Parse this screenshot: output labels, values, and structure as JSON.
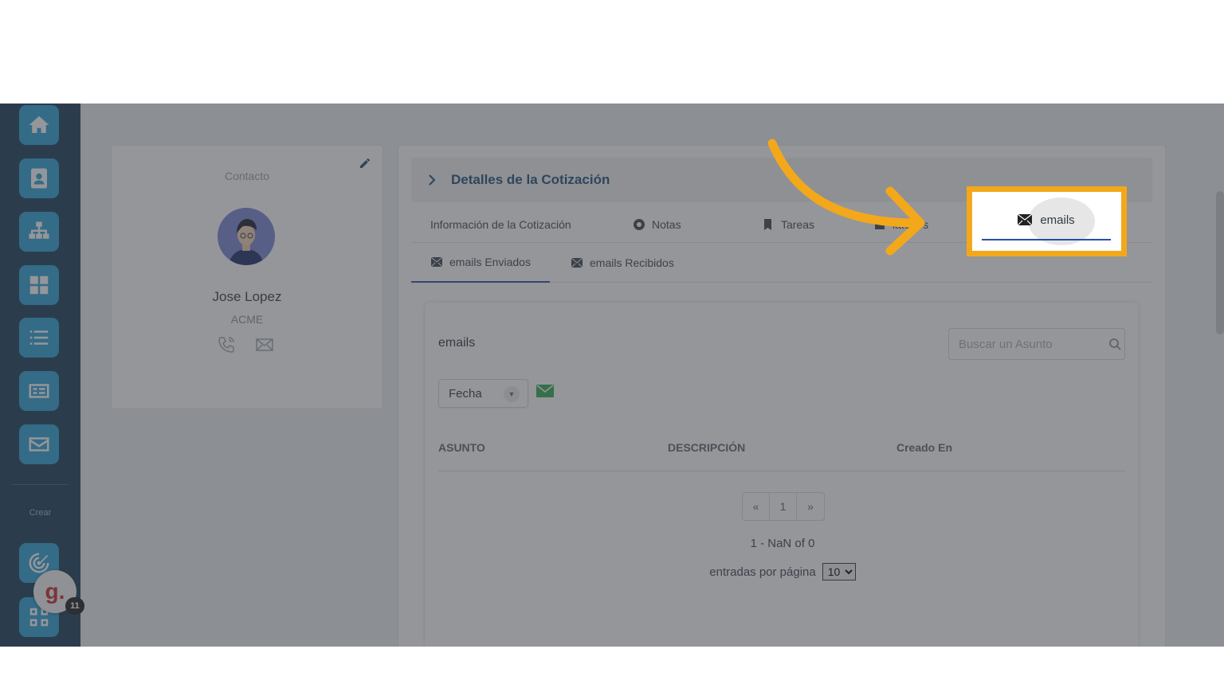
{
  "sidebar": {
    "items": [
      {
        "name": "home-icon"
      },
      {
        "name": "contacts-icon"
      },
      {
        "name": "org-chart-icon"
      },
      {
        "name": "grid-icon"
      },
      {
        "name": "list-icon"
      },
      {
        "name": "money-icon"
      },
      {
        "name": "mail-icon"
      }
    ],
    "crear_label": "Crear",
    "bottom_items": [
      {
        "name": "target-icon"
      },
      {
        "name": "apps-icon"
      }
    ],
    "chat_avatar_letter": "g.",
    "chat_badge": "11"
  },
  "contact": {
    "title": "Contacto",
    "name": "Jose Lopez",
    "company": "ACME"
  },
  "details": {
    "title": "Detalles de la Cotización",
    "tabs": [
      {
        "label": "Información de la Cotización",
        "icon": ""
      },
      {
        "label": "Notas",
        "icon": "notes-icon"
      },
      {
        "label": "Tareas",
        "icon": "tasks-icon"
      },
      {
        "label": "latorios",
        "icon": "reminders-icon"
      },
      {
        "label": "emails",
        "icon": "mail-icon",
        "active": true
      }
    ],
    "subtabs": [
      {
        "label": "emails Enviados",
        "active": true
      },
      {
        "label": "emails Recibidos"
      }
    ]
  },
  "emails_panel": {
    "title": "emails",
    "search_placeholder": "Buscar un Asunto",
    "sort_value": "Fecha",
    "columns": [
      "ASUNTO",
      "DESCRIPCIÓN",
      "Creado En"
    ],
    "pager": {
      "prev": "«",
      "page": "1",
      "next": "»"
    },
    "range_text": "1 - NaN of 0",
    "per_page_label": "entradas por página",
    "per_page_value": "10"
  },
  "colors": {
    "sidebar_bg": "#173b57",
    "sidebar_button": "#2a9fd8",
    "accent_blue": "#1e4d76",
    "highlight_orange": "#f3a81b",
    "mail_green": "#2fa84f"
  }
}
